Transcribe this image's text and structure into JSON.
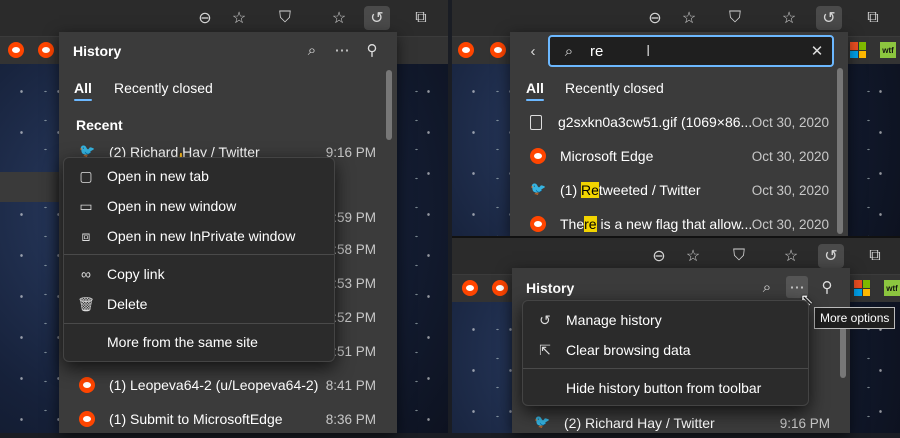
{
  "left": {
    "panel_title": "History",
    "tabs": [
      "All",
      "Recently closed"
    ],
    "section": "Recent",
    "rows": [
      {
        "icon": "twitter",
        "text": "(2) Richard Hay / Twitter",
        "time": "9:16 PM"
      },
      {
        "icon": "reddit",
        "text": "",
        "time": "9:59 PM"
      },
      {
        "icon": "reddit",
        "text": "",
        "time": "9:58 PM"
      },
      {
        "icon": "reddit",
        "text": "",
        "time": "8:53 PM"
      },
      {
        "icon": "reddit",
        "text": "",
        "time": "8:52 PM"
      },
      {
        "icon": "reddit",
        "text": "",
        "time": "8:51 PM"
      },
      {
        "icon": "reddit",
        "text": "(1) Leopeva64-2 (u/Leopeva64-2)...",
        "time": "8:41 PM"
      },
      {
        "icon": "reddit",
        "text": "(1) Submit to MicrosoftEdge",
        "time": "8:36 PM"
      }
    ],
    "context_menu": [
      {
        "icon": "new-tab-icon",
        "label": "Open in new tab"
      },
      {
        "icon": "new-window-icon",
        "label": "Open in new window"
      },
      {
        "icon": "inprivate-window-icon",
        "label": "Open in new InPrivate window"
      },
      {
        "icon": "link-icon",
        "label": "Copy link"
      },
      {
        "icon": "trash-icon",
        "label": "Delete"
      },
      {
        "icon": "",
        "label": "More from the same site"
      }
    ]
  },
  "right_top": {
    "search_value": "re",
    "tabs": [
      "All",
      "Recently closed"
    ],
    "rows": [
      {
        "icon": "file",
        "text": "g2sxkn0a3cw51.gif (1069×86...",
        "time": "Oct 30, 2020"
      },
      {
        "icon": "reddit",
        "text": "Microsoft Edge",
        "time": "Oct 30, 2020"
      },
      {
        "icon": "twitter",
        "pre": "(1) ",
        "hl": "Re",
        "post": "tweeted / Twitter",
        "time": "Oct 30, 2020"
      },
      {
        "icon": "reddit",
        "pre": "The",
        "hl": "re",
        "post": " is a new flag that allow...",
        "time": "Oct 30, 2020"
      }
    ]
  },
  "right_bottom": {
    "panel_title": "History",
    "menu": [
      {
        "icon": "history-icon",
        "label": "Manage history"
      },
      {
        "icon": "external-link-icon",
        "label": "Clear browsing data"
      },
      {
        "icon": "",
        "label": "Hide history button from toolbar"
      }
    ],
    "tooltip": "More options",
    "row": {
      "icon": "twitter",
      "text": "(2) Richard Hay / Twitter",
      "time": "9:16 PM"
    }
  },
  "favicons": {
    "wtf": "wtf"
  },
  "colors": {
    "accent": "#6cb8ff",
    "highlight": "#f2d400",
    "reddit": "#ff4500",
    "twitter": "#1da1f2"
  }
}
